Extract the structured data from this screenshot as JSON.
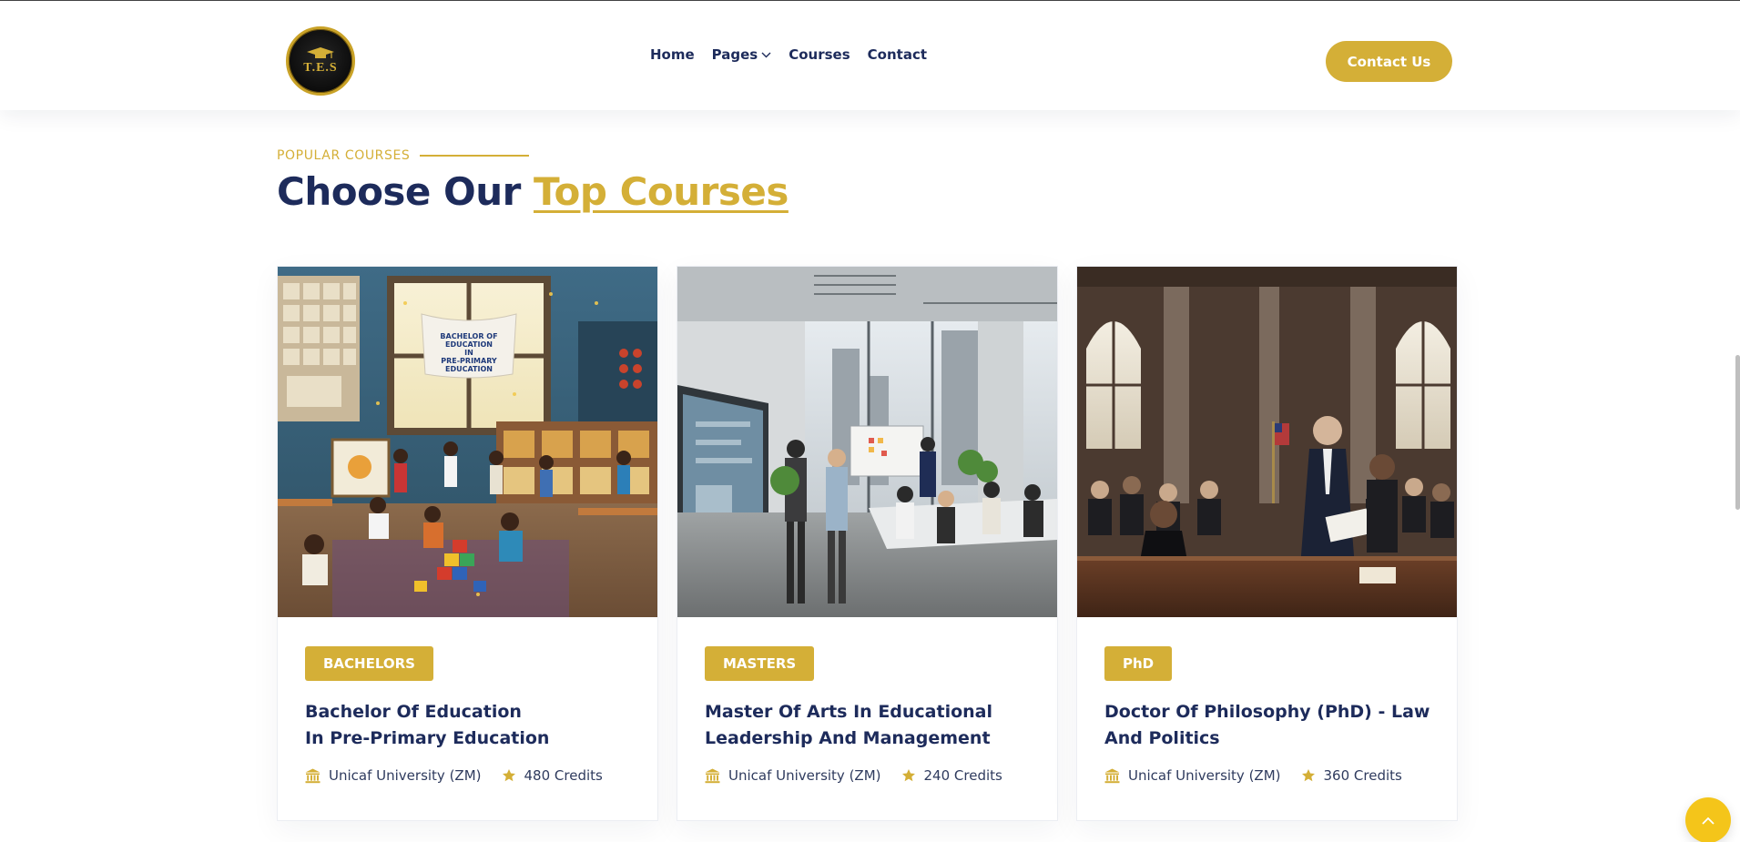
{
  "header": {
    "logo_text": "T.E.S",
    "nav": [
      {
        "label": "Home"
      },
      {
        "label": "Pages",
        "has_dropdown": true
      },
      {
        "label": "Courses"
      },
      {
        "label": "Contact"
      }
    ],
    "cta_label": "Contact Us"
  },
  "section": {
    "eyebrow": "POPULAR COURSES",
    "title_plain": "Choose Our ",
    "title_accent": "Top Courses"
  },
  "courses": [
    {
      "badge": "BACHELORS",
      "title_line1": "Bachelor Of Education",
      "title_line2": "In Pre-Primary Education",
      "university": "Unicaf University (ZM)",
      "credits": "480 Credits",
      "image_banner": [
        "BACHELOR OF",
        "EDUCATION",
        "IN",
        "PRE-PRIMARY",
        "EDUCATION"
      ]
    },
    {
      "badge": "MASTERS",
      "title_line1": "Master Of Arts In Educational",
      "title_line2": "Leadership And Management",
      "university": "Unicaf University (ZM)",
      "credits": "240 Credits"
    },
    {
      "badge": "PhD",
      "title_line1": "Doctor Of Philosophy (PhD) - Law",
      "title_line2": "And Politics",
      "university": "Unicaf University (ZM)",
      "credits": "360 Credits"
    }
  ],
  "colors": {
    "brand_gold": "#d4af37",
    "navy": "#1d2b5b",
    "scroll_button": "#f4c51a"
  },
  "icons": {
    "dropdown": "chevron-down-icon",
    "university": "institution-icon",
    "credits": "star-icon",
    "scroll_top": "chevron-up-icon"
  }
}
